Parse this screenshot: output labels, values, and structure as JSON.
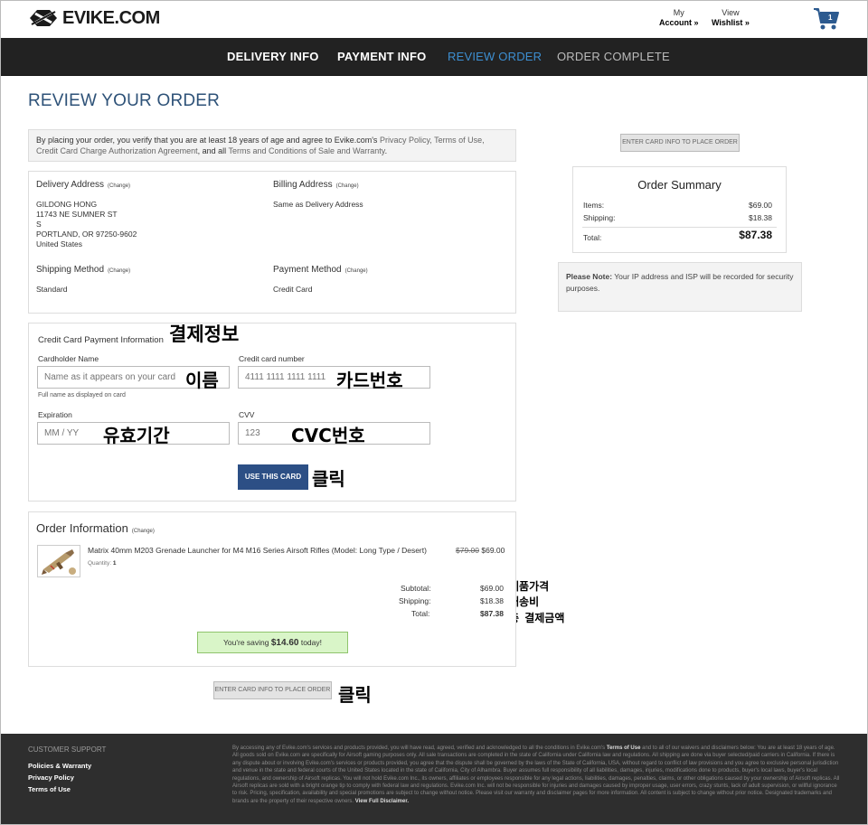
{
  "header": {
    "logo": "EVIKE.COM",
    "account": {
      "line1": "My",
      "line2": "Account »"
    },
    "wishlist": {
      "line1": "View",
      "line2": "Wishlist »"
    },
    "cart_count": "1"
  },
  "steps": [
    {
      "label": "DELIVERY INFO",
      "color": "#ffffff"
    },
    {
      "label": "PAYMENT INFO",
      "color": "#ffffff"
    },
    {
      "label": "REVIEW ORDER",
      "color": "#3d8fd1"
    },
    {
      "label": "ORDER COMPLETE",
      "color": "#bbbbbb"
    }
  ],
  "page_title": "REVIEW YOUR ORDER",
  "agreement": {
    "t1": "By placing your order, you verify that you are at least 18 years of age and agree to Evike.com's",
    "l1": "Privacy Policy, Terms of Use, Credit Card Charge",
    "l2": "Authorization Agreement",
    "t2": ", and all",
    "l3": "Terms and Conditions of Sale and Warranty",
    "t3": "."
  },
  "change": "(Change)",
  "delivery": {
    "label": "Delivery Address",
    "lines": "GILDONG HONG\n11743 NE SUMNER ST\nS\nPORTLAND, OR 97250-9602\nUnited States"
  },
  "billing": {
    "label": "Billing Address",
    "value": "Same as Delivery Address"
  },
  "shipping_method": {
    "label": "Shipping Method",
    "value": "Standard"
  },
  "payment_method": {
    "label": "Payment Method",
    "value": "Credit Card"
  },
  "card": {
    "title": "Credit Card Payment Information",
    "holder_label": "Cardholder Name",
    "holder_placeholder": "Name as it appears on your card",
    "holder_hint": "Full name as displayed on card",
    "number_label": "Credit card number",
    "number_placeholder": "4111 1111 1111 1111",
    "exp_label": "Expiration",
    "exp_placeholder": "MM / YY",
    "cvv_label": "CVV",
    "cvv_placeholder": "123",
    "use_button": "USE THIS CARD"
  },
  "annotations": {
    "payment_info": "결제정보",
    "name": "이름",
    "card_number": "카드번호",
    "expiry": "유효기간",
    "cvc": "CVC번호",
    "click1": "클릭",
    "price": "제품가격",
    "shipping": "배송비",
    "total": "총 결제금액",
    "click2": "클릭"
  },
  "order_info": {
    "title": "Order Information",
    "product": "Matrix 40mm M203 Grenade Launcher for M4 M16 Series Airsoft Rifles (Model: Long Type / Desert)",
    "quantity_label": "Quantity:",
    "quantity": "1",
    "old_price": "$79.00",
    "price": "$69.00",
    "subtotal_label": "Subtotal:",
    "subtotal": "$69.00",
    "shipping_label": "Shipping:",
    "shipping": "$18.38",
    "total_label": "Total:",
    "total": "$87.38",
    "saving_pre": "You're saving",
    "saving_amount": "$14.60",
    "saving_post": "today!"
  },
  "place_order": "ENTER CARD INFO TO PLACE ORDER",
  "summary": {
    "title": "Order Summary",
    "items_label": "Items:",
    "items": "$69.00",
    "shipping_label": "Shipping:",
    "shipping": "$18.38",
    "total_label": "Total:",
    "total": "$87.38"
  },
  "note": {
    "bold": "Please Note:",
    "text": "Your IP address and ISP will be recorded for security purposes."
  },
  "footer": {
    "title": "CUSTOMER SUPPORT",
    "links": [
      "Policies & Warranty",
      "Privacy Policy",
      "Terms of Use"
    ],
    "legal_a": "By accessing any of Evike.com's services and products provided, you will have read, agreed, verified and acknowledged to all the conditions in Evike.com's",
    "legal_tou": "Terms of Use",
    "legal_b": "and to all of our waivers and disclaimers below: You are at least 18 years of age. All goods sold on Evike.com are specifically for Airsoft gaming purposes only. All sale transactions are completed in the state of California under California law and regulations. All shipping are done via buyer selected/paid carriers in California. If there is any dispute about or involving Evike.com's services or products provided, you agree that the dispute shall be governed by the laws of the State of California, USA, without regard to conflict of law provisions and you agree to exclusive personal jurisdiction and venue in the state and federal courts of the United States located in the state of California, City of Alhambra. Buyer assumes full responsibility of all liabilities, damages, injuries, modifications done to products, buyer's local laws, buyer's local regulations, and ownership of Airsoft replicas. You will not hold Evike.com Inc., its owners, affiliates or employees responsible for any legal actions, liabilities, damages, penalties, claims, or other obligations caused by your ownership of Airsoft replicas. All Airsoft replicas are sold with a bright orange tip to comply with federal law and regulations. Evike.com Inc. will not be responsible for injuries and damages caused by improper usage, user errors, crazy stunts, lack of adult supervision, or willful ignorance to risk. Pricing, specification, availability and special promotions are subject to change without notice. Please visit our warranty and disclaimer pages for more information. All content is subject to change without prior notice. Designated trademarks and brands are the property of their respective owners.",
    "legal_link": "View Full Disclaimer."
  }
}
